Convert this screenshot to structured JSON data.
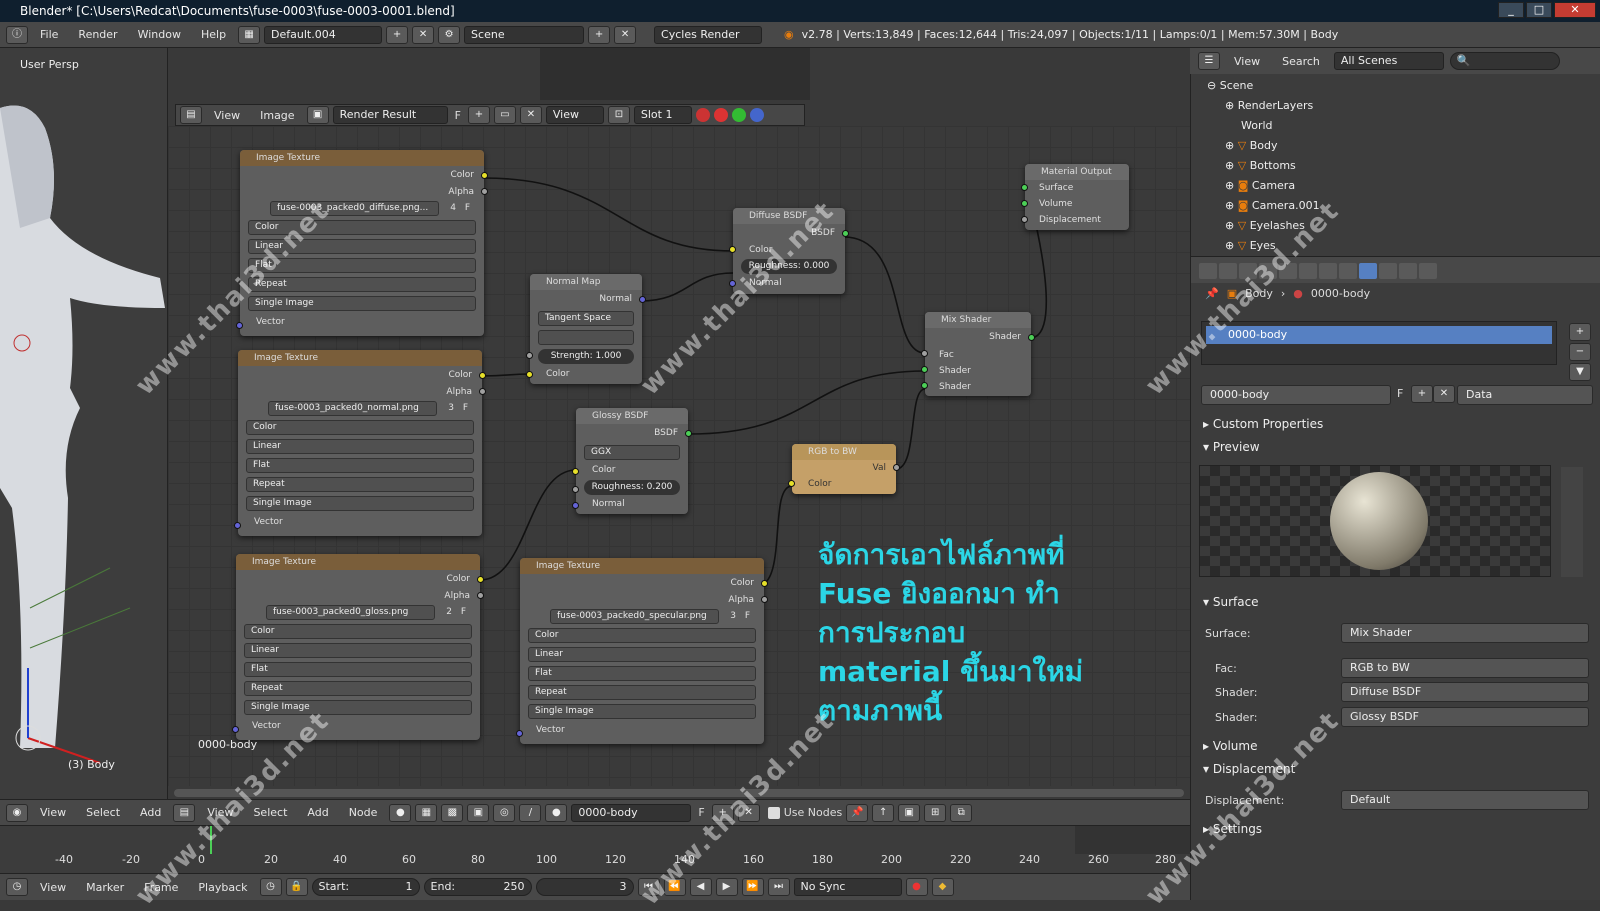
{
  "window": {
    "title": "Blender* [C:\\Users\\Redcat\\Documents\\fuse-0003\\fuse-0003-0001.blend]",
    "min": "_",
    "max": "□",
    "close": "✕"
  },
  "info": {
    "menus": [
      "File",
      "Render",
      "Window",
      "Help"
    ],
    "layout": "Default.004",
    "scene": "Scene",
    "engine": "Cycles Render",
    "stats": "v2.78 | Verts:13,849 | Faces:12,644 | Tris:24,097 | Objects:1/11 | Lamps:0/1 | Mem:57.30M | Body"
  },
  "viewport": {
    "label": "User Persp",
    "object": "(3) Body"
  },
  "image_editor": {
    "view": "View",
    "image": "Image",
    "image_name": "Render Result",
    "f": "F",
    "view_dd": "View",
    "slot": "Slot 1"
  },
  "nodes": {
    "tex1": {
      "title": "Image Texture",
      "color": "Color",
      "alpha": "Alpha",
      "file": "fuse-0003_packed0_diffuse.png...",
      "users": "4",
      "f": "F",
      "color_mode": "Color",
      "interp": "Linear",
      "proj": "Flat",
      "ext": "Repeat",
      "src": "Single Image",
      "vector": "Vector"
    },
    "tex2": {
      "title": "Image Texture",
      "color": "Color",
      "alpha": "Alpha",
      "file": "fuse-0003_packed0_normal.png",
      "users": "3",
      "f": "F",
      "color_mode": "Color",
      "interp": "Linear",
      "proj": "Flat",
      "ext": "Repeat",
      "src": "Single Image",
      "vector": "Vector"
    },
    "tex3": {
      "title": "Image Texture",
      "color": "Color",
      "alpha": "Alpha",
      "file": "fuse-0003_packed0_gloss.png",
      "users": "2",
      "f": "F",
      "color_mode": "Color",
      "interp": "Linear",
      "proj": "Flat",
      "ext": "Repeat",
      "src": "Single Image",
      "vector": "Vector"
    },
    "tex4": {
      "title": "Image Texture",
      "color": "Color",
      "alpha": "Alpha",
      "file": "fuse-0003_packed0_specular.png",
      "users": "3",
      "f": "F",
      "color_mode": "Color",
      "interp": "Linear",
      "proj": "Flat",
      "ext": "Repeat",
      "src": "Single Image",
      "vector": "Vector"
    },
    "normalmap": {
      "title": "Normal Map",
      "normal": "Normal",
      "space": "Tangent Space",
      "strength": "Strength:",
      "strength_val": "1.000",
      "color": "Color"
    },
    "diffuse": {
      "title": "Diffuse BSDF",
      "bsdf": "BSDF",
      "color": "Color",
      "roughness": "Roughness:",
      "roughness_val": "0.000",
      "normal": "Normal"
    },
    "glossy": {
      "title": "Glossy BSDF",
      "bsdf": "BSDF",
      "dist": "GGX",
      "color": "Color",
      "roughness": "Roughness:",
      "roughness_val": "0.200",
      "normal": "Normal"
    },
    "rgbbw": {
      "title": "RGB to BW",
      "val": "Val",
      "color": "Color"
    },
    "mix": {
      "title": "Mix Shader",
      "shader_out": "Shader",
      "fac": "Fac",
      "shader1": "Shader",
      "shader2": "Shader"
    },
    "output": {
      "title": "Material Output",
      "surface": "Surface",
      "volume": "Volume",
      "displacement": "Displacement"
    }
  },
  "node_material_label": "0000-body",
  "annotation": [
    "จัดการเอาไฟล์ภาพที่",
    "Fuse ยิงออกมา ทำ",
    "การประกอบ",
    "material ขึ้นมาใหม่",
    "ตามภาพนี้"
  ],
  "node_footer": {
    "menus": [
      "View",
      "Select",
      "Add"
    ],
    "menus2": [
      "View",
      "Select",
      "Add",
      "Node"
    ],
    "material": "0000-body",
    "f": "F",
    "use_nodes": "Use Nodes"
  },
  "timeline": {
    "ticks": [
      "-40",
      "-20",
      "0",
      "20",
      "40",
      "60",
      "80",
      "100",
      "120",
      "140",
      "160",
      "180",
      "200",
      "220",
      "240",
      "260",
      "280"
    ],
    "menus": [
      "View",
      "Marker",
      "Frame",
      "Playback"
    ],
    "start_label": "Start:",
    "start": "1",
    "end_label": "End:",
    "end": "250",
    "current": "3",
    "sync": "No Sync"
  },
  "outliner": {
    "view": "View",
    "search": "Search",
    "filter": "All Scenes",
    "items": [
      "Scene",
      "RenderLayers",
      "World",
      "Body",
      "Bottoms",
      "Camera",
      "Camera.001",
      "Eyelashes",
      "Eyes"
    ]
  },
  "properties": {
    "object": "Body",
    "material": "0000-body",
    "slot": "0000-body",
    "mat_field": "0000-body",
    "f": "F",
    "link": "Data",
    "sections": {
      "custom": "Custom Properties",
      "preview": "Preview",
      "surface": "Surface",
      "volume": "Volume",
      "displacement": "Displacement",
      "settings": "Settings"
    },
    "surface_label": "Surface:",
    "surface_val": "Mix Shader",
    "fac_label": "Fac:",
    "fac_val": "RGB to BW",
    "shader1_label": "Shader:",
    "shader1_val": "Diffuse BSDF",
    "shader2_label": "Shader:",
    "shader2_val": "Glossy BSDF",
    "disp_label": "Displacement:",
    "disp_val": "Default"
  },
  "watermark": "www.thai3d.net",
  "colors": {
    "annotation": "#2bd6e6",
    "selected": "#5680c2",
    "socket_color": "#e7e02a",
    "socket_shader": "#4ccf57",
    "socket_vector": "#6464d6"
  }
}
